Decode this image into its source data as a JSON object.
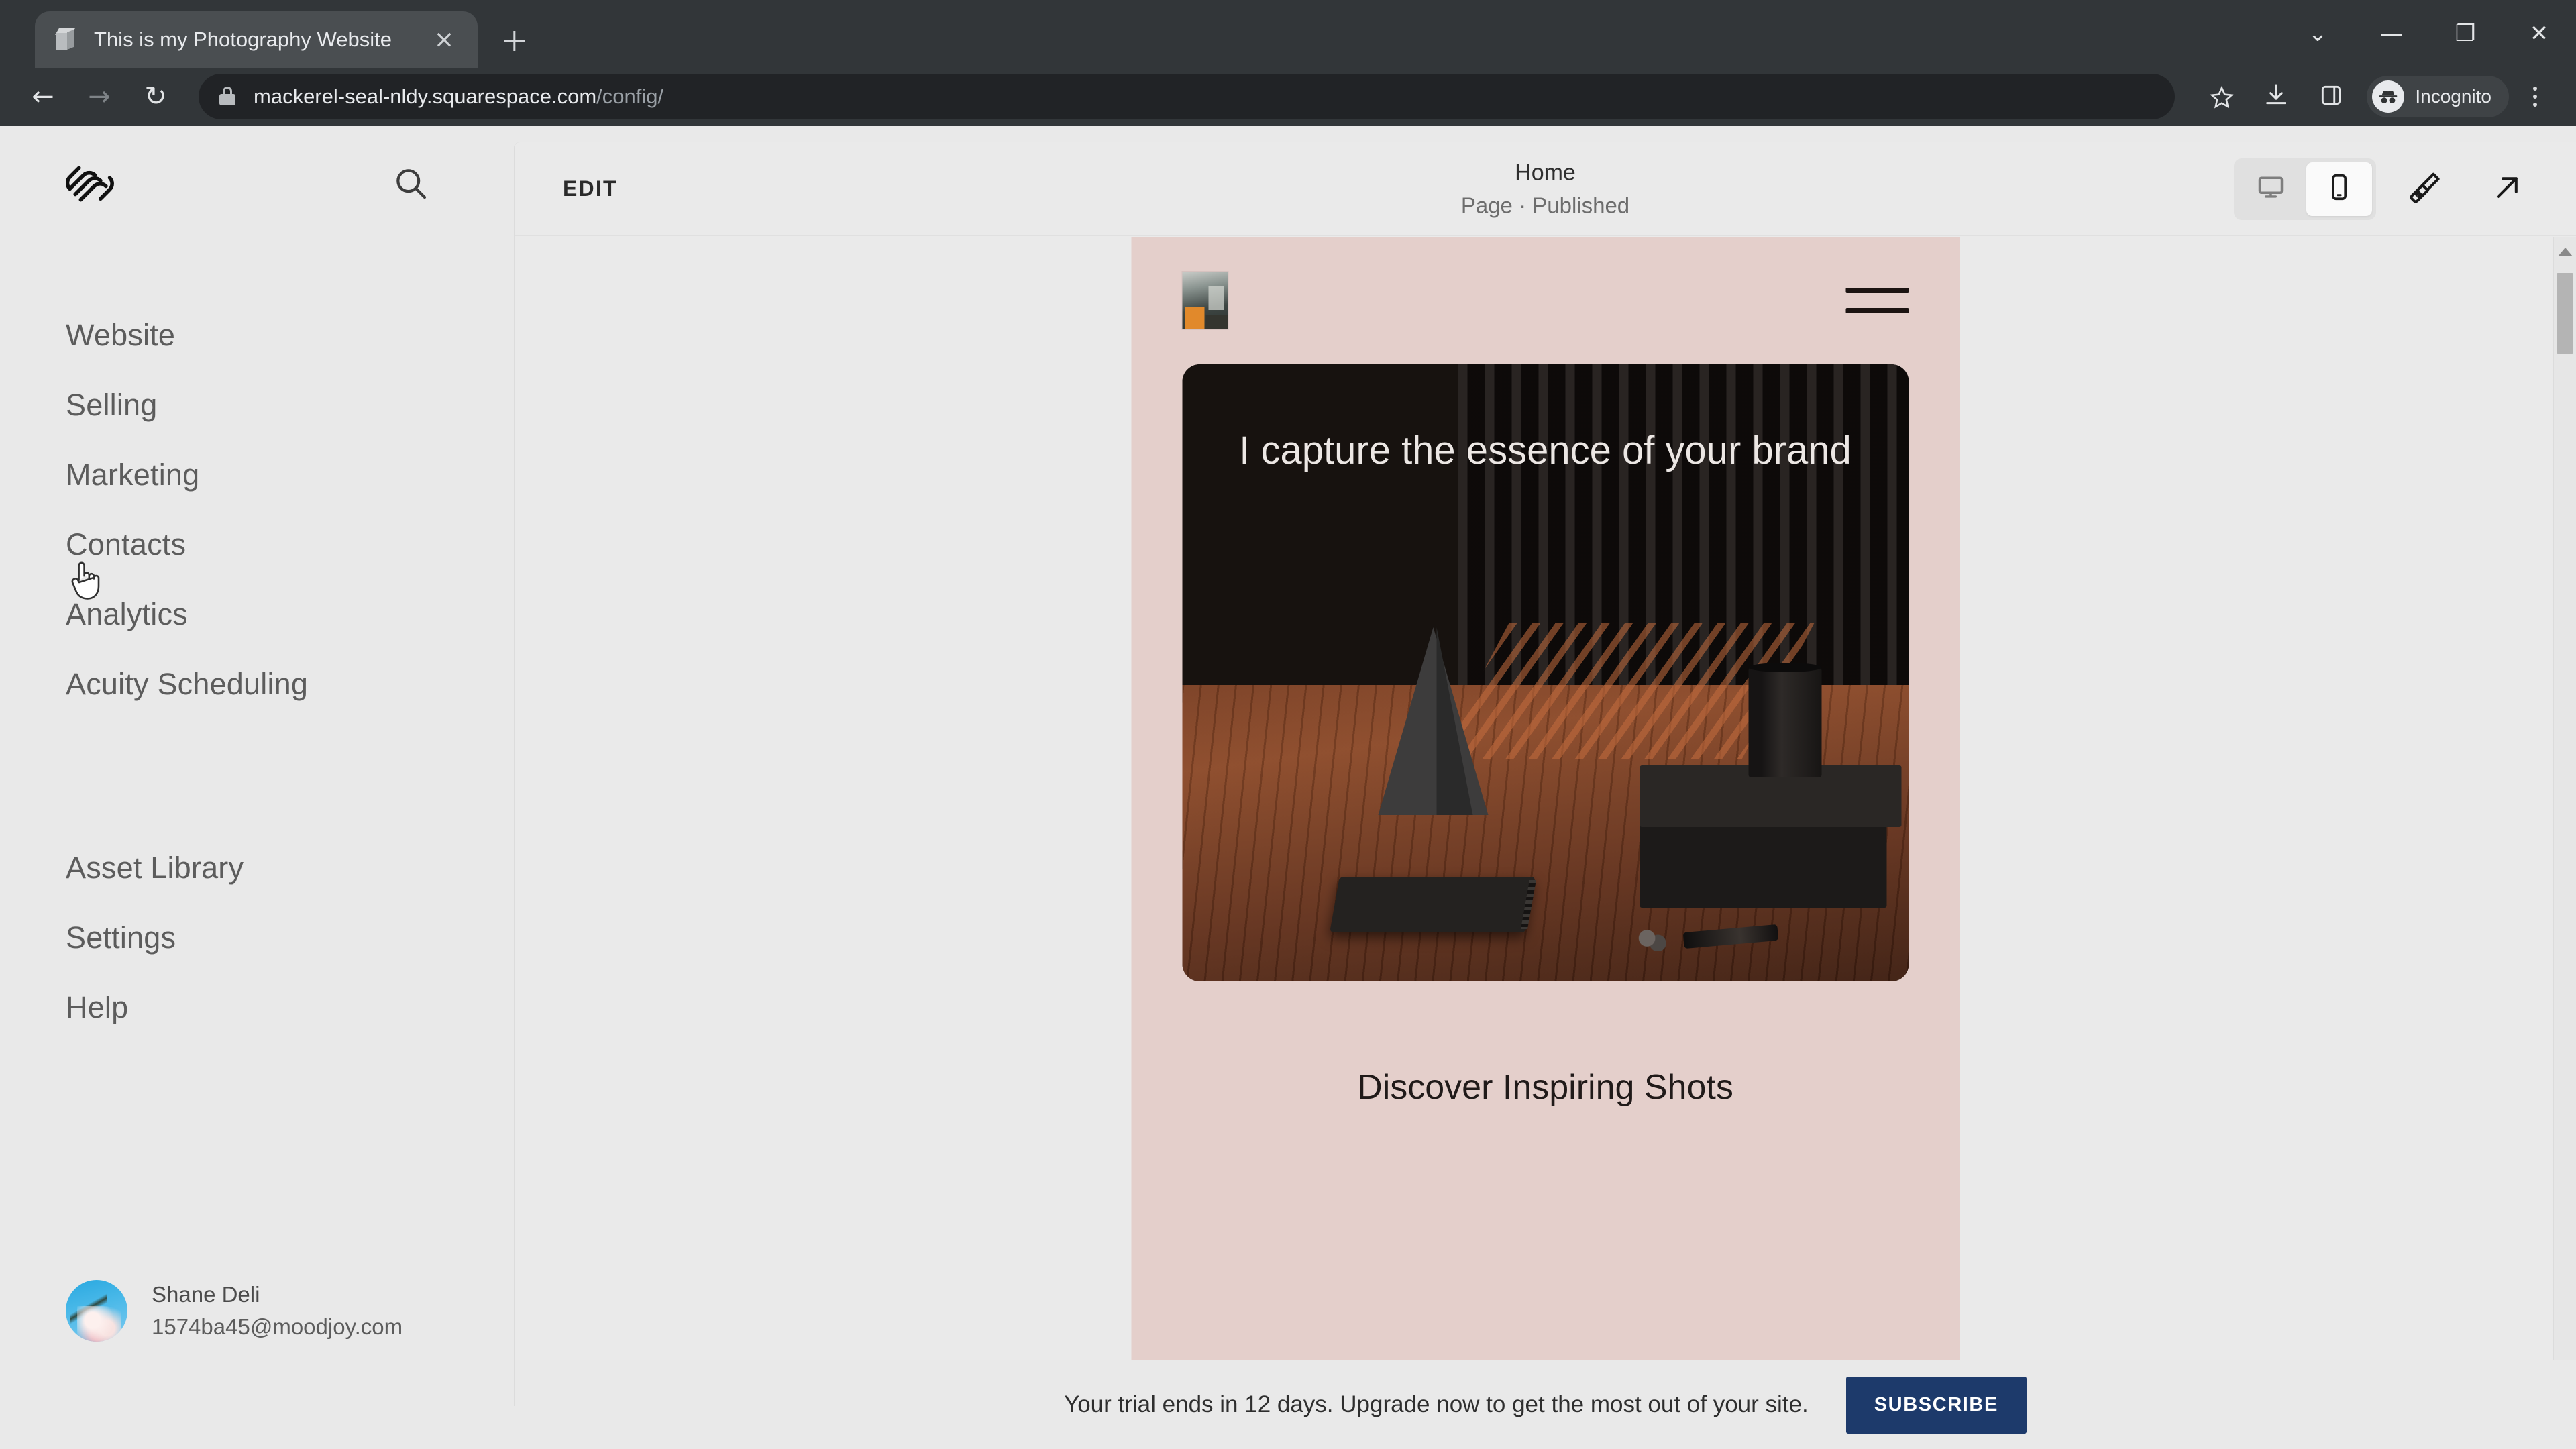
{
  "browser": {
    "tab": {
      "title": "This is my Photography Website",
      "favicon": "cube-icon",
      "close": "close-icon"
    },
    "new_tab": "+",
    "window_controls": [
      {
        "name": "tab-search",
        "glyph": "⌄"
      },
      {
        "name": "minimize",
        "glyph": "—"
      },
      {
        "name": "restore",
        "glyph": "❐"
      },
      {
        "name": "close",
        "glyph": "✕"
      }
    ],
    "nav": {
      "back": "←",
      "forward": "→",
      "reload": "↻"
    },
    "url": {
      "host": "mackerel-seal-nldy.squarespace.com",
      "path": "/config/",
      "security": "lock-icon"
    },
    "actions": {
      "bookmark": "star-icon",
      "download": "download-icon",
      "side_panel": "side-panel-icon",
      "incognito_label": "Incognito",
      "menu": "kebab-menu-icon"
    }
  },
  "sidebar": {
    "logo": "squarespace-logo",
    "search": "search-icon",
    "primary_items": [
      {
        "label": "Website"
      },
      {
        "label": "Selling"
      },
      {
        "label": "Marketing"
      },
      {
        "label": "Contacts"
      },
      {
        "label": "Analytics"
      },
      {
        "label": "Acuity Scheduling"
      }
    ],
    "secondary_items": [
      {
        "label": "Asset Library"
      },
      {
        "label": "Settings"
      },
      {
        "label": "Help"
      }
    ],
    "account": {
      "name": "Shane Deli",
      "email": "1574ba45@moodjoy.com",
      "avatar": "user-avatar"
    }
  },
  "panel": {
    "edit_label": "EDIT",
    "page_title": "Home",
    "page_status": "Page · Published",
    "device_toggle": [
      {
        "name": "desktop-view",
        "icon": "monitor-icon",
        "active": false
      },
      {
        "name": "mobile-view",
        "icon": "phone-icon",
        "active": true
      }
    ],
    "style_icon": "paintbrush-icon",
    "open_icon": "external-link-icon"
  },
  "preview": {
    "background_color": "#e4cfcb",
    "logo": "site-logo-thumbnail",
    "menu": "hamburger-menu-icon",
    "hero_heading": "I capture the essence of your brand",
    "section_title": "Discover Inspiring Shots",
    "scrollbar": "preview-scrollbar"
  },
  "trial": {
    "message": "Your trial ends in 12 days. Upgrade now to get the most out of your site.",
    "cta": "SUBSCRIBE",
    "cta_color": "#1d3a6b"
  }
}
